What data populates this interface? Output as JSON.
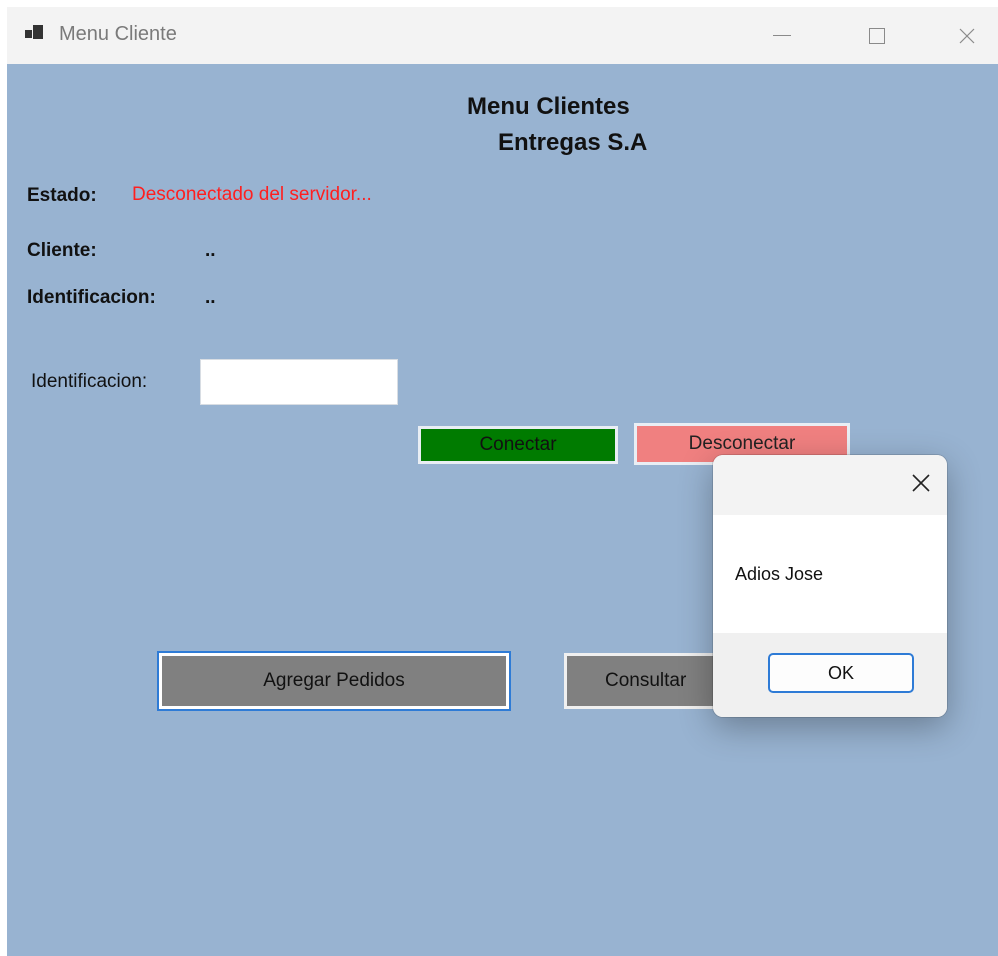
{
  "window": {
    "title": "Menu Cliente"
  },
  "form": {
    "heading_line1": "Menu Clientes",
    "heading_line2": "Entregas S.A",
    "estado_label": "Estado:",
    "estado_value": "Desconectado del servidor...",
    "cliente_label": "Cliente:",
    "cliente_value": "..",
    "identificacion_label": "Identificacion:",
    "identificacion_value": "..",
    "input_label": "Identificacion:",
    "input_value": "",
    "conectar_label": "Conectar",
    "desconectar_label": "Desconectar",
    "agregar_label": "Agregar Pedidos",
    "consultar_label": "Consultar"
  },
  "dialog": {
    "message": "Adios Jose",
    "ok_label": "OK"
  },
  "colors": {
    "form_background": "#98b3d1",
    "status_red": "#ff1f1f",
    "conectar_green": "#007b00",
    "desconectar_pink": "#f08080",
    "button_gray": "#808080",
    "focus_blue": "#2e7bd6"
  },
  "icons": {
    "app": "app-icon",
    "minimize": "minimize-icon",
    "maximize": "maximize-icon",
    "close": "close-icon",
    "dialog_close": "close-icon"
  }
}
